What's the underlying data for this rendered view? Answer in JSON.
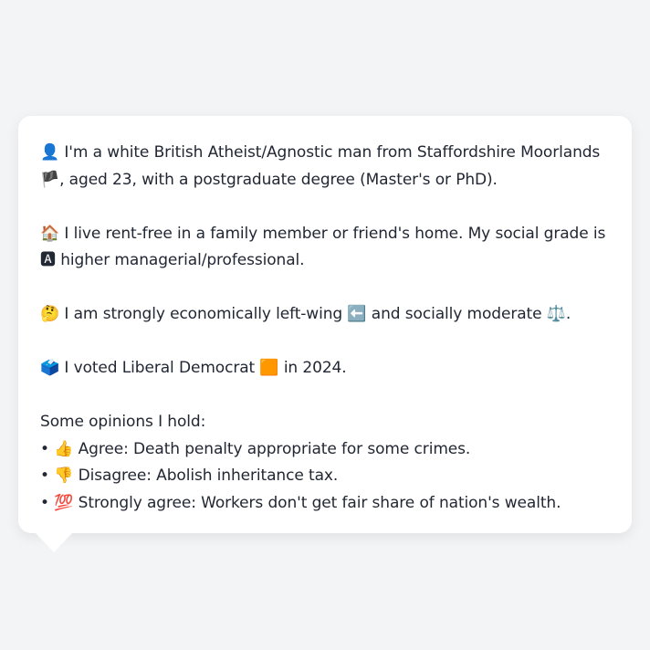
{
  "bio": {
    "identity_emoji": "👤",
    "identity_text": "I'm a white British Atheist/Agnostic man from Staffordshire Moorlands",
    "flag_emoji": "🏴",
    "identity_text_2": ", aged 23, with a postgraduate degree (Master's or PhD).",
    "housing_emoji": "🏠",
    "housing_text": "I live rent-free in a family member or friend's home. My social grade is",
    "grade_emoji": "🅰",
    "housing_text_2": "higher managerial/professional.",
    "politics_emoji": "🤔",
    "politics_text_1": "I am strongly economically left-wing",
    "left_emoji": "⬅️",
    "politics_text_2": "and socially moderate",
    "scale_emoji": "⚖️",
    "politics_text_3": ".",
    "vote_emoji": "🗳️",
    "vote_text_1": "I voted Liberal Democrat",
    "party_emoji": "🟧",
    "vote_text_2": "in 2024."
  },
  "opinions": {
    "heading": "Some opinions I hold:",
    "items": [
      {
        "bullet": "•",
        "emoji": "👍",
        "text": "Agree: Death penalty appropriate for some crimes."
      },
      {
        "bullet": "•",
        "emoji": "👎",
        "text": "Disagree: Abolish inheritance tax."
      },
      {
        "bullet": "•",
        "emoji": "💯",
        "text": "Strongly agree: Workers don't get fair share of nation's wealth."
      }
    ]
  },
  "colors": {
    "background": "#f3f4f6",
    "bubble": "#ffffff",
    "text": "#212733"
  }
}
